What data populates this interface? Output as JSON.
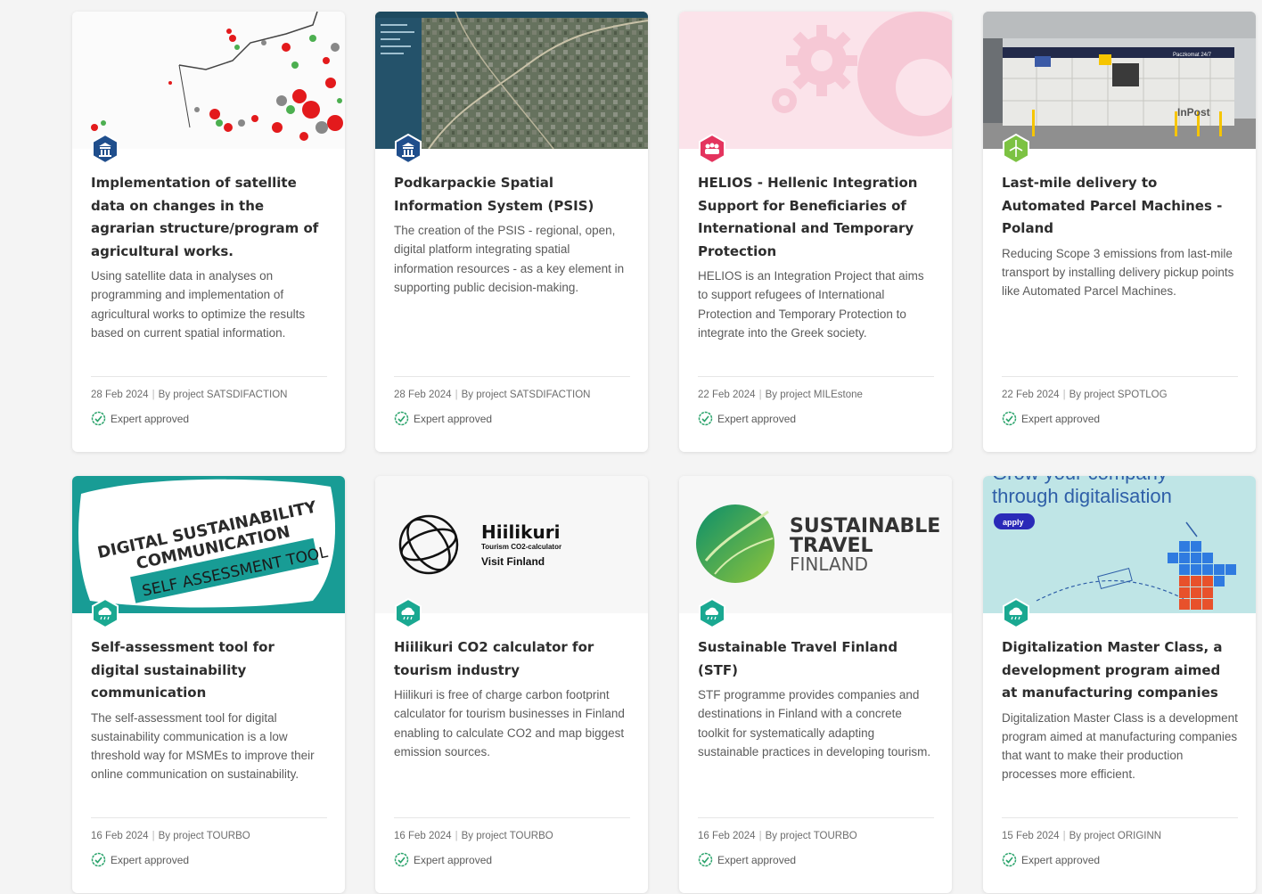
{
  "cards": [
    {
      "title": "Implementation of satellite data on changes in the agrarian structure/program of agricultural works.",
      "description": "Using satellite data in analyses on programming and implementation of agricultural works to optimize the results based on current spatial information.",
      "date": "28 Feb 2024",
      "project": "By project SATSDIFACTION",
      "approved": "Expert approved",
      "badge_icon": "building-icon",
      "badge_color": "#1f4e8c"
    },
    {
      "title": "Podkarpackie Spatial Information System (PSIS)",
      "description": "The creation of the PSIS - regional, open, digital platform integrating spatial information resources - as a key element in supporting public decision-making.",
      "date": "28 Feb 2024",
      "project": "By project SATSDIFACTION",
      "approved": "Expert approved",
      "badge_icon": "building-icon",
      "badge_color": "#1f4e8c"
    },
    {
      "title": "HELIOS - Hellenic Integration Support for Beneficiaries of International and Temporary Protection",
      "description": "HELIOS is an Integration Project that aims to support refugees of International Protection and Temporary Protection to integrate into the Greek society.",
      "date": "22 Feb 2024",
      "project": "By project MILEstone",
      "approved": "Expert approved",
      "badge_icon": "people-icon",
      "badge_color": "#e4345e"
    },
    {
      "title": "Last-mile delivery to Automated Parcel Machines - Poland",
      "description": "Reducing Scope 3 emissions from last-mile transport by installing delivery pickup points like Automated Parcel Machines.",
      "date": "22 Feb 2024",
      "project": "By project SPOTLOG",
      "approved": "Expert approved",
      "badge_icon": "wind-turbine-icon",
      "badge_color": "#7cc242"
    },
    {
      "title": "Self-assessment tool for digital sustainability communication",
      "description": "The self-assessment tool for digital sustainability communication is a low threshold way for MSMEs to improve their online communication on sustainability.",
      "date": "16 Feb 2024",
      "project": "By project TOURBO",
      "approved": "Expert approved",
      "badge_icon": "cloud-icon",
      "badge_color": "#1aa891"
    },
    {
      "title": "Hiilikuri CO2 calculator for tourism industry",
      "description": "Hiilikuri is free of charge carbon footprint calculator for tourism businesses in Finland enabling to calculate CO2 and map biggest emission sources.",
      "date": "16 Feb 2024",
      "project": "By project TOURBO",
      "approved": "Expert approved",
      "badge_icon": "cloud-icon",
      "badge_color": "#1aa891"
    },
    {
      "title": "Sustainable Travel Finland (STF)",
      "description": "STF programme provides companies and destinations in Finland with a concrete toolkit for systematically adapting sustainable practices in developing tourism.",
      "date": "16 Feb 2024",
      "project": "By project TOURBO",
      "approved": "Expert approved",
      "badge_icon": "cloud-icon",
      "badge_color": "#1aa891"
    },
    {
      "title": "Digitalization Master Class, a development program aimed at manufacturing companies",
      "description": "Digitalization Master Class is a development program aimed at manufacturing companies that want to make their production processes more efficient.",
      "date": "15 Feb 2024",
      "project": "By project ORIGINN",
      "approved": "Expert approved",
      "badge_icon": "cloud-icon",
      "badge_color": "#1aa891"
    }
  ],
  "thumb_text": {
    "parcel_brand": "InPost",
    "parcel_sign": "Paczkomat 24/7",
    "dsc_line1": "DIGITAL SUSTAINABILITY",
    "dsc_line2": "COMMUNICATION",
    "dsc_ribbon": "SELF ASSESSMENT TOOL",
    "hiilikuri_name": "Hiilikuri",
    "hiilikuri_sub": "Tourism CO2-calculator",
    "hiilikuri_brand": "Visit Finland",
    "stf_line1": "SUSTAINABLE",
    "stf_line2": "TRAVEL",
    "stf_line3": "FINLAND",
    "dmc_top": "Grow your company",
    "dmc_headline": "through digitalisation",
    "dmc_apply": "apply"
  }
}
